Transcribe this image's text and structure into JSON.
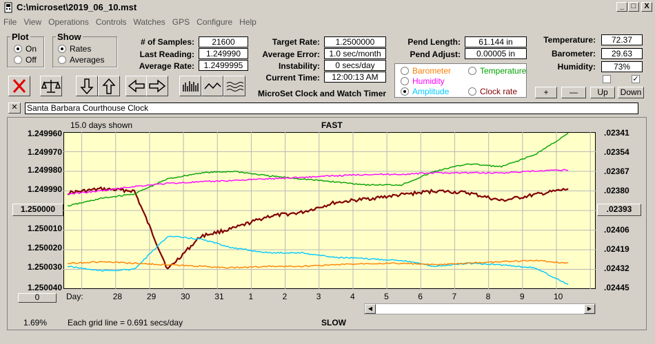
{
  "window": {
    "title": "C:\\microset\\2019_06_10.mst",
    "controls": [
      "_",
      "□",
      "X"
    ]
  },
  "menu": [
    "File",
    "View",
    "Operations",
    "Controls",
    "Watches",
    "GPS",
    "Configure",
    "Help"
  ],
  "plot_group": {
    "title": "Plot",
    "options": [
      "On",
      "Off"
    ],
    "selected": "On"
  },
  "show_group": {
    "title": "Show",
    "options": [
      "Rates",
      "Averages"
    ],
    "selected": "Rates"
  },
  "stats": {
    "samples_label": "# of Samples:",
    "samples": "21600",
    "last_label": "Last Reading:",
    "last": "1.249990",
    "avg_label": "Average Rate:",
    "avg": "1.2499995",
    "target_label": "Target Rate:",
    "target": "1.2500000",
    "avgerr_label": "Average Error:",
    "avgerr": "1.0 sec/month",
    "instab_label": "Instability:",
    "instab": "0 secs/day",
    "time_label": "Current Time:",
    "time": "12:00:13 AM",
    "pendlen_label": "Pend Length:",
    "pendlen": "61.144 in",
    "pendadj_label": "Pend Adjust:",
    "pendadj": "0.00005 in",
    "temp_label": "Temperature:",
    "temp": "72.37",
    "baro_label": "Barometer:",
    "baro": "29.63",
    "hum_label": "Humidity:",
    "hum": "73%"
  },
  "app_title": "MicroSet Clock and Watch Timer",
  "legend": {
    "items": [
      {
        "label": "Barometer",
        "color": "#ff8000",
        "selected": false
      },
      {
        "label": "Temperature",
        "color": "#00a000",
        "selected": false
      },
      {
        "label": "Humidity",
        "color": "#ff00ff",
        "selected": false
      },
      {
        "label": "Amplitude",
        "color": "#00c8ff",
        "selected": true
      },
      {
        "label": "Clock rate",
        "color": "#800000",
        "selected": false
      }
    ]
  },
  "right_buttons": {
    "plus": "+",
    "minus": "—",
    "up": "Up",
    "down": "Down"
  },
  "checkbox_right_checked": "✓",
  "name_close": "✕",
  "clock_name": "Santa Barbara Courthouse Clock",
  "chart": {
    "days_shown": "15.0 days shown",
    "fast_label": "FAST",
    "slow_label": "SLOW",
    "grid_note": "Each grid line = 0.691 secs/day",
    "percent": "1.69%",
    "day_prefix": "Day:",
    "offset_button": "0",
    "left_axis": [
      "1.249960",
      "1.249970",
      "1.249980",
      "1.249990",
      "1.250000",
      "1.250010",
      "1.250020",
      "1.250030",
      "1.250040"
    ],
    "left_center_button": "1.250000",
    "right_axis": [
      ".02341",
      ".02354",
      ".02367",
      ".02380",
      ".02393",
      ".02406",
      ".02419",
      ".02432",
      ".02445"
    ],
    "right_center_button": ".02393",
    "days": [
      "28",
      "29",
      "30",
      "31",
      "1",
      "2",
      "3",
      "4",
      "5",
      "6",
      "7",
      "8",
      "9",
      "10"
    ]
  },
  "chart_data": {
    "type": "line",
    "x": [
      0,
      1,
      2,
      3,
      4,
      5,
      6,
      7,
      8,
      9,
      10,
      11,
      12,
      13,
      14,
      15
    ],
    "y_left_range": [
      1.25004,
      1.24996
    ],
    "y_right_range": [
      0.02445,
      0.02341
    ],
    "series": [
      {
        "name": "Clock rate",
        "color": "#800000",
        "values": [
          1.249991,
          1.249989,
          1.24999,
          1.25003,
          1.250013,
          1.250009,
          1.250003,
          1.250001,
          1.249996,
          1.249994,
          1.249992,
          1.24999,
          1.249991,
          1.249995,
          1.249992,
          1.249989
        ]
      },
      {
        "name": "Temperature",
        "color": "#00a000",
        "values": [
          0.0239,
          0.02385,
          0.02382,
          0.02372,
          0.02368,
          0.02367,
          0.0237,
          0.02372,
          0.02374,
          0.02376,
          0.02376,
          0.02367,
          0.02362,
          0.02364,
          0.02356,
          0.02342
        ]
      },
      {
        "name": "Humidity",
        "color": "#ff00ff",
        "values": [
          0.02382,
          0.0238,
          0.02377,
          0.02375,
          0.02374,
          0.02373,
          0.02372,
          0.02371,
          0.0237,
          0.02369,
          0.02369,
          0.02368,
          0.02368,
          0.02368,
          0.02367,
          0.02366
        ]
      },
      {
        "name": "Amplitude",
        "color": "#00c8ff",
        "values": [
          0.0243,
          0.02433,
          0.02432,
          0.0241,
          0.02412,
          0.02418,
          0.02421,
          0.02421,
          0.02424,
          0.02425,
          0.02426,
          0.0243,
          0.02428,
          0.02429,
          0.02431,
          0.02442
        ]
      },
      {
        "name": "Barometer",
        "color": "#ff8000",
        "values": [
          0.02428,
          0.02427,
          0.02428,
          0.02429,
          0.0243,
          0.02431,
          0.0243,
          0.0243,
          0.02429,
          0.02428,
          0.02428,
          0.02429,
          0.02428,
          0.02427,
          0.02426,
          0.02428
        ]
      }
    ]
  }
}
